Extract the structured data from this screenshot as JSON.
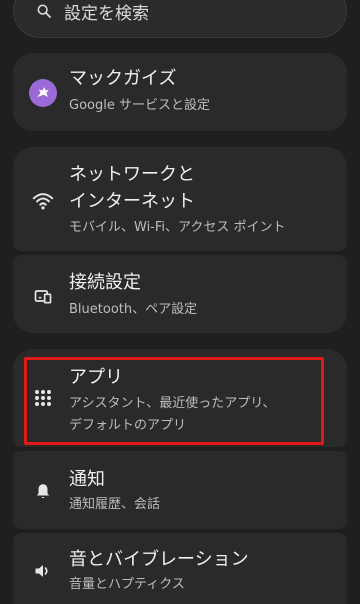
{
  "search": {
    "placeholder": "設定を検索",
    "icon": "search-icon"
  },
  "items": [
    {
      "title": "マックガイズ",
      "subtitle": "Google サービスと設定",
      "icon": "avatar-icon",
      "accent": "#9b6ad8"
    },
    {
      "title_line1": "ネットワークと",
      "title_line2": "インターネット",
      "subtitle": "モバイル、Wi-Fi、アクセス ポイント",
      "icon": "wifi-icon"
    },
    {
      "title": "接続設定",
      "subtitle": "Bluetooth、ペア設定",
      "icon": "connected-devices-icon"
    },
    {
      "title": "アプリ",
      "subtitle_line1": "アシスタント、最近使ったアプリ、",
      "subtitle_line2": "デフォルトのアプリ",
      "icon": "apps-grid-icon"
    },
    {
      "title": "通知",
      "subtitle": "通知履歴、会話",
      "icon": "bell-icon"
    },
    {
      "title": "音とバイブレーション",
      "subtitle": "音量とハプティクス",
      "icon": "volume-icon"
    }
  ],
  "colors": {
    "background": "#1f1f1f",
    "card": "#2a2a2a",
    "highlight": "#e01919"
  }
}
